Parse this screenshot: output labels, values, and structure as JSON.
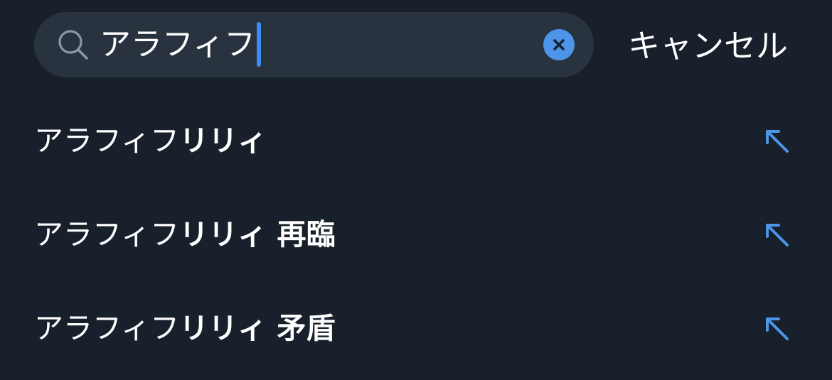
{
  "search": {
    "query": "アラフィフ",
    "clear_icon": "clear-icon",
    "search_icon": "search-icon"
  },
  "cancel_label": "キャンセル",
  "suggestions": [
    {
      "prefix": "アラフィフ",
      "completion": "リリィ",
      "action_icon": "arrow-up-left-icon"
    },
    {
      "prefix": "アラフィフ",
      "completion": "リリィ 再臨",
      "action_icon": "arrow-up-left-icon"
    },
    {
      "prefix": "アラフィフ",
      "completion": "リリィ 矛盾",
      "action_icon": "arrow-up-left-icon"
    }
  ],
  "colors": {
    "background": "#18202b",
    "search_field": "#29333f",
    "accent": "#4c95e8",
    "caret": "#3b8ef0",
    "text": "#ffffff"
  }
}
